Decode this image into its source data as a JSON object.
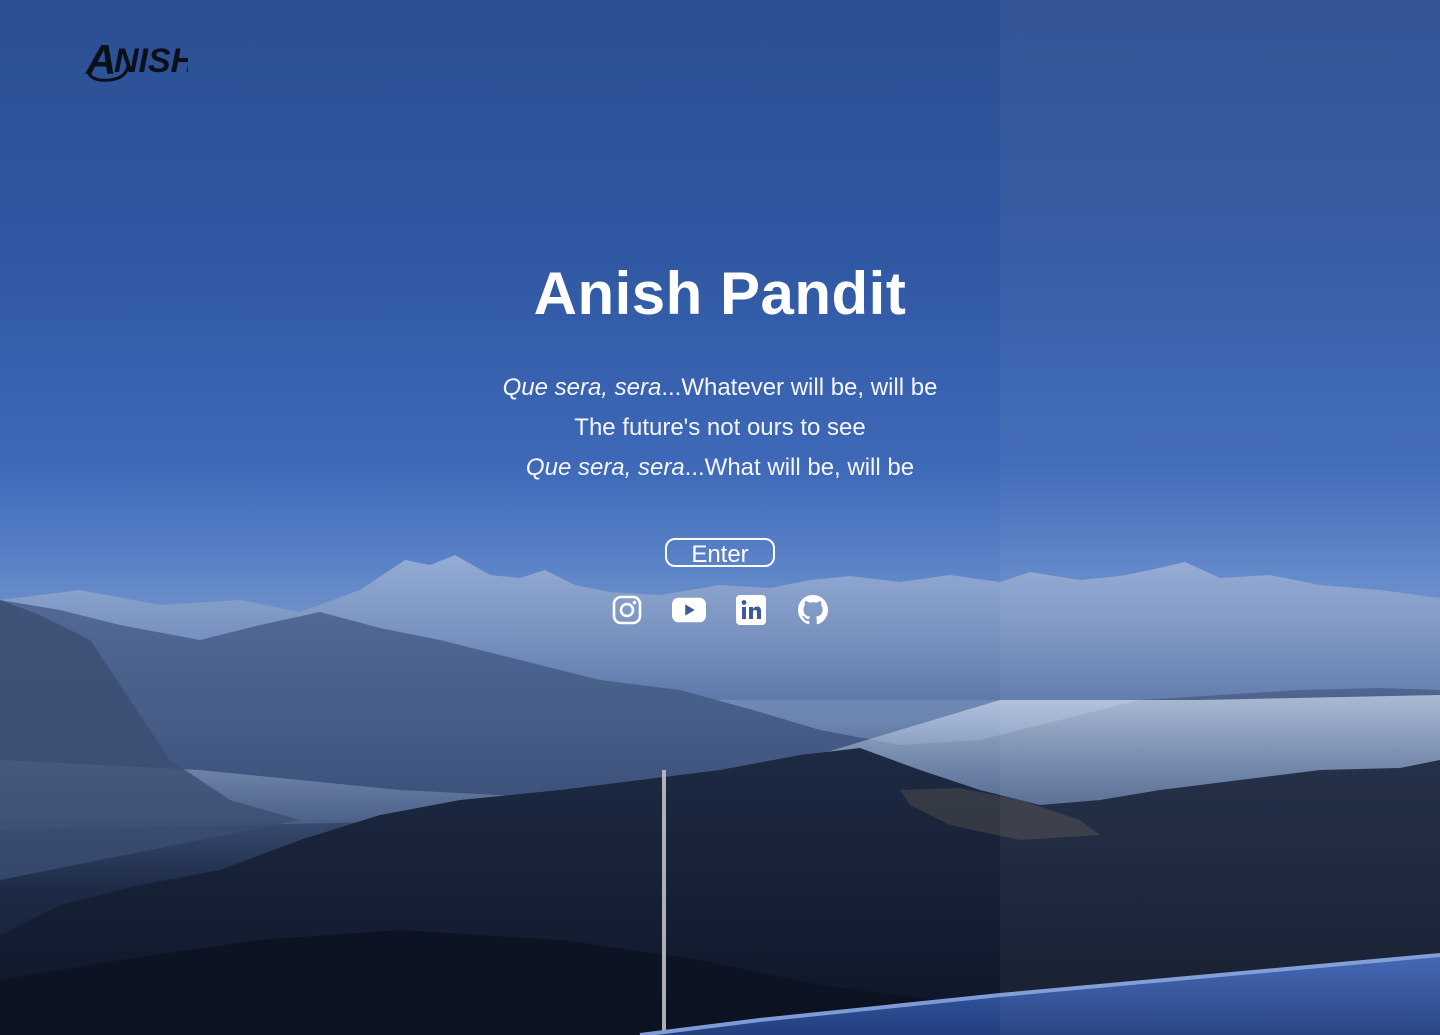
{
  "logo": {
    "text": "ANISH",
    "icon": "anish-logo"
  },
  "hero": {
    "title": "Anish Pandit",
    "lyrics": [
      {
        "italic": "Que sera, sera",
        "rest": "...Whatever will be, will be"
      },
      {
        "italic": "",
        "rest": "The future's not ours to see"
      },
      {
        "italic": "Que sera, sera",
        "rest": "...What will be, will be"
      }
    ],
    "enter_label": "Enter"
  },
  "socials": [
    {
      "icon": "instagram-icon"
    },
    {
      "icon": "youtube-icon"
    },
    {
      "icon": "linkedin-icon"
    },
    {
      "icon": "github-icon"
    }
  ],
  "colors": {
    "sky_top": "#2b4f93",
    "sky_mid": "#3e69b8",
    "mountain_dark": "#121b2e",
    "text": "#ffffff"
  }
}
